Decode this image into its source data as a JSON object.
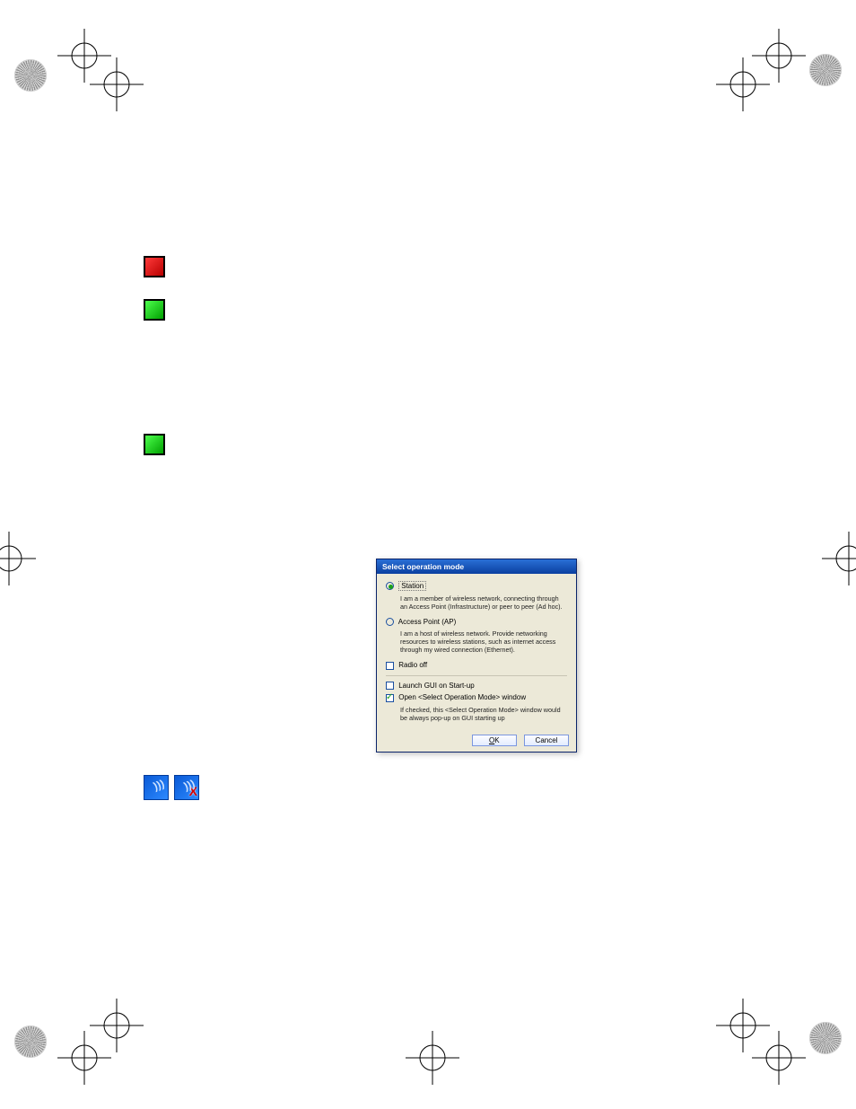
{
  "icons_top": {
    "red_desc": "",
    "green_desc": ""
  },
  "icons_mid": {
    "green_desc": ""
  },
  "ap_icons": {
    "pair_desc": ""
  },
  "dialog": {
    "title": "Select operation mode",
    "station": {
      "label": "Station",
      "desc": "I am a member of wireless network, connecting through an Access Point (Infrastructure) or peer to peer (Ad hoc)."
    },
    "ap": {
      "label": "Access Point (AP)",
      "desc": "I am a host of wireless network. Provide networking resources to wireless stations, such as internet access through my wired connection (Ethernet)."
    },
    "radio_off": "Radio off",
    "launch_gui": "Launch GUI on Start-up",
    "open_window": "Open <Select Operation Mode> window",
    "open_window_desc": "If checked, this <Select Operation Mode> window would be always pop-up on GUI starting up",
    "ok_label": "OK",
    "cancel_label": "Cancel"
  }
}
